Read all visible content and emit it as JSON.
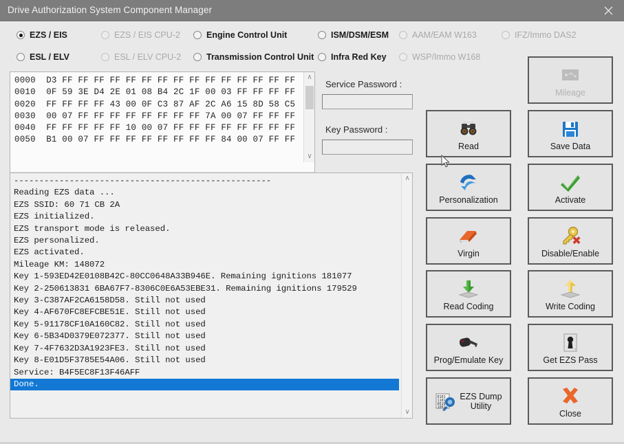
{
  "window": {
    "title": "Drive Authorization System Component Manager",
    "close_label": "×",
    "close_icon": "close-icon"
  },
  "component_selector": {
    "options": [
      {
        "label": "EZS / EIS",
        "selected": true,
        "enabled": true,
        "col": 0,
        "row": 0
      },
      {
        "label": "ESL / ELV",
        "selected": false,
        "enabled": true,
        "col": 0,
        "row": 1
      },
      {
        "label": "EZS / EIS CPU-2",
        "selected": false,
        "enabled": false,
        "col": 1,
        "row": 0
      },
      {
        "label": "ESL / ELV CPU-2",
        "selected": false,
        "enabled": false,
        "col": 1,
        "row": 1
      },
      {
        "label": "Engine Control Unit",
        "selected": false,
        "enabled": true,
        "col": 2,
        "row": 0
      },
      {
        "label": "Transmission Control Unit",
        "selected": false,
        "enabled": true,
        "col": 2,
        "row": 1
      },
      {
        "label": "ISM/DSM/ESM",
        "selected": false,
        "enabled": true,
        "col": 3,
        "row": 0
      },
      {
        "label": "Infra Red Key",
        "selected": false,
        "enabled": true,
        "col": 3,
        "row": 1
      },
      {
        "label": "AAM/EAM W163",
        "selected": false,
        "enabled": false,
        "col": 4,
        "row": 0
      },
      {
        "label": "WSP/Immo W168",
        "selected": false,
        "enabled": false,
        "col": 4,
        "row": 1
      },
      {
        "label": "IFZ/Immo DAS2",
        "selected": false,
        "enabled": false,
        "col": 5,
        "row": 0
      }
    ]
  },
  "hex_view": {
    "lines": [
      "0000  D3 FF FF FF FF FF FF FF FF FF FF FF FF FF FF FF",
      "0010  0F 59 3E D4 2E 01 08 B4 2C 1F 00 03 FF FF FF FF",
      "0020  FF FF FF FF 43 00 0F C3 87 AF 2C A6 15 8D 58 C5",
      "0030  00 07 FF FF FF FF FF FF FF FF 7A 00 07 FF FF FF",
      "0040  FF FF FF FF FF 10 00 07 FF FF FF FF FF FF FF FF",
      "0050  B1 00 07 FF FF FF FF FF FF FF FF 84 00 07 FF FF"
    ],
    "scroll_up_glyph": "∧",
    "scroll_down_glyph": "∨",
    "scroll_left_glyph": "‹",
    "scroll_right_glyph": "›"
  },
  "log_view": {
    "lines": [
      "---------------------------------------------------",
      "Reading EZS data ...",
      "EZS SSID: 60 71 CB 2A",
      "EZS initialized.",
      "EZS transport mode is released.",
      "EZS personalized.",
      "EZS activated.",
      "Mileage KM: 148072",
      "Key 1-593ED42E0108B42C-80CC0648A33B946E. Remaining ignitions 181077",
      "Key 2-250613831 6BA67F7-8306C0E6A53EBE31. Remaining ignitions 179529",
      "Key 3-C387AF2CA6158D58. Still not used",
      "Key 4-AF670FC8EFCBE51E. Still not used",
      "Key 5-91178CF10A160C82. Still not used",
      "Key 6-5B34D0379E072377. Still not used",
      "Key 7-4F7632D3A1923FE3. Still not used",
      "Key 8-E01D5F3785E54A06. Still not used",
      "Service: B4F5EC8F13F46AFF"
    ],
    "selected_line": "Done.",
    "scroll_up_glyph": "∧",
    "scroll_down_glyph": "∨"
  },
  "passwords": {
    "service_label": "Service Password :",
    "service_value": "",
    "service_placeholder": "",
    "key_label": "Key Password :",
    "key_value": "",
    "key_placeholder": ""
  },
  "actions": [
    {
      "label": "Mileage",
      "icon": "mileage-icon",
      "enabled": false,
      "col": 1,
      "row": 0
    },
    {
      "label": "Read",
      "icon": "binoculars-icon",
      "enabled": true,
      "col": 0,
      "row": 1
    },
    {
      "label": "Save Data",
      "icon": "floppy-disk-icon",
      "enabled": true,
      "col": 1,
      "row": 1
    },
    {
      "label": "Personalization",
      "icon": "refresh-arrows-icon",
      "enabled": true,
      "col": 0,
      "row": 2
    },
    {
      "label": "Activate",
      "icon": "green-check-icon",
      "enabled": true,
      "col": 1,
      "row": 2
    },
    {
      "label": "Virgin",
      "icon": "eraser-icon",
      "enabled": true,
      "col": 0,
      "row": 3
    },
    {
      "label": "Disable/Enable",
      "icon": "key-cross-icon",
      "enabled": true,
      "col": 1,
      "row": 3
    },
    {
      "label": "Read Coding",
      "icon": "download-green-icon",
      "enabled": true,
      "col": 0,
      "row": 4
    },
    {
      "label": "Write Coding",
      "icon": "upload-yellow-icon",
      "enabled": true,
      "col": 1,
      "row": 4
    },
    {
      "label": "Prog/Emulate Key",
      "icon": "car-key-icon",
      "enabled": true,
      "col": 0,
      "row": 5
    },
    {
      "label": "Get EZS Pass",
      "icon": "keyhole-icon",
      "enabled": true,
      "col": 1,
      "row": 5
    },
    {
      "label": "EZS Dump\nUtility",
      "icon": "binary-chip-icon",
      "enabled": true,
      "col": 0,
      "row": 6
    },
    {
      "label": "Close",
      "icon": "orange-x-icon",
      "enabled": true,
      "col": 1,
      "row": 6
    }
  ],
  "colors": {
    "titlebar": "#7d7d7d",
    "client_bg": "#e9e9e9",
    "selection": "#1278d4",
    "button_border": "#5a5a5a",
    "accent_blue": "#1e78c8",
    "accent_green": "#3d9a33",
    "accent_orange": "#e8672b",
    "accent_yellow": "#e8c64b"
  }
}
